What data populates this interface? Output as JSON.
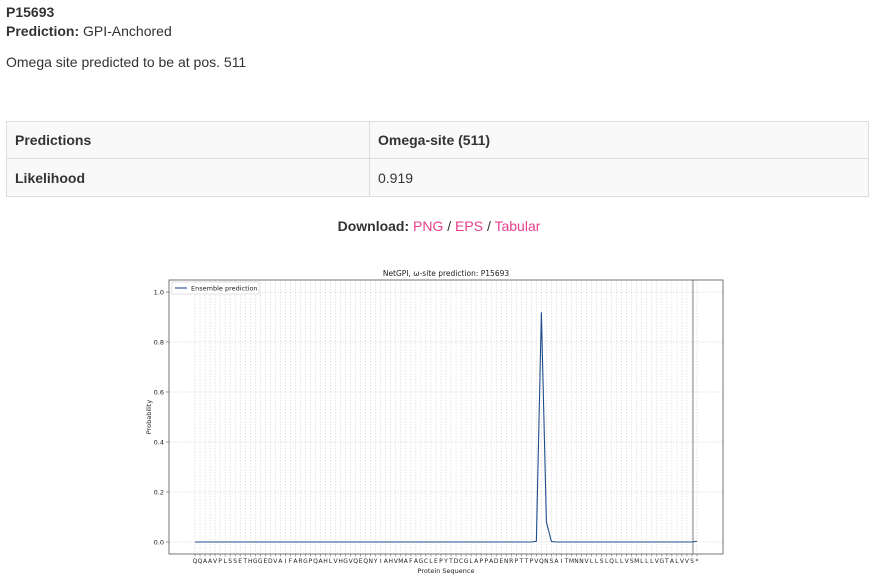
{
  "header": {
    "sequence_id": "P15693",
    "prediction_label": "Prediction:",
    "prediction_value": "GPI-Anchored",
    "omega_text": "Omega site predicted to be at pos. 511"
  },
  "results_table": {
    "rows": [
      {
        "label": "Predictions",
        "value": "Omega-site (511)"
      },
      {
        "label": "Likelihood",
        "value": "0.919"
      }
    ]
  },
  "download": {
    "label": "Download:",
    "links": [
      "PNG",
      "EPS",
      "Tabular"
    ],
    "separator": "/",
    "link_color": "#e83e8c"
  },
  "chart_data": {
    "type": "line",
    "title": "NetGPI, ω-site prediction: P15693",
    "xlabel": "Protein Sequence",
    "ylabel": "Probability",
    "ylim": [
      0,
      1.05
    ],
    "yticks": [
      "0.0",
      "0.2",
      "0.4",
      "0.6",
      "0.8",
      "1.0"
    ],
    "legend": {
      "position": "top-left"
    },
    "grid": true,
    "x": [
      "Q",
      "Q",
      "A",
      "A",
      "V",
      "P",
      "L",
      "S",
      "S",
      "E",
      "T",
      "H",
      "G",
      "G",
      "E",
      "D",
      "V",
      "A",
      "I",
      "F",
      "A",
      "R",
      "G",
      "P",
      "Q",
      "A",
      "H",
      "L",
      "V",
      "H",
      "G",
      "V",
      "Q",
      "E",
      "Q",
      "N",
      "Y",
      "I",
      "A",
      "H",
      "V",
      "M",
      "A",
      "F",
      "A",
      "G",
      "C",
      "L",
      "E",
      "P",
      "Y",
      "T",
      "D",
      "C",
      "G",
      "L",
      "A",
      "P",
      "P",
      "A",
      "D",
      "E",
      "N",
      "R",
      "P",
      "T",
      "T",
      "P",
      "V",
      "Q",
      "N",
      "S",
      "A",
      "I",
      "T",
      "M",
      "N",
      "N",
      "V",
      "L",
      "L",
      "S",
      "L",
      "Q",
      "L",
      "L",
      "V",
      "S",
      "M",
      "L",
      "L",
      "L",
      "V",
      "G",
      "T",
      "A",
      "L",
      "V",
      "V",
      "S",
      "*"
    ],
    "series": [
      {
        "name": "Ensemble prediction",
        "color": "#1f4e8c",
        "values": [
          0,
          0,
          0,
          0,
          0,
          0,
          0,
          0,
          0,
          0,
          0,
          0,
          0,
          0,
          0,
          0,
          0,
          0,
          0,
          0,
          0,
          0,
          0,
          0,
          0,
          0,
          0,
          0,
          0,
          0,
          0,
          0,
          0,
          0,
          0,
          0,
          0,
          0,
          0,
          0,
          0,
          0,
          0,
          0,
          0,
          0,
          0,
          0,
          0,
          0,
          0,
          0,
          0,
          0,
          0,
          0,
          0,
          0,
          0,
          0,
          0,
          0,
          0,
          0,
          0,
          0,
          0,
          0,
          0.003,
          0.919,
          0.08,
          0.002,
          0,
          0,
          0,
          0,
          0,
          0,
          0,
          0,
          0,
          0,
          0,
          0,
          0,
          0,
          0,
          0,
          0,
          0,
          0,
          0,
          0,
          0,
          0,
          0,
          0,
          0,
          0,
          0,
          0.003
        ]
      }
    ]
  }
}
